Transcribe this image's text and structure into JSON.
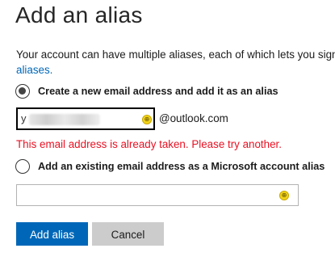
{
  "page": {
    "title": "Add an alias",
    "description_line1": "Your account can have multiple aliases, each of which lets you sign",
    "description_link": "aliases."
  },
  "options": {
    "new_email_label": "Create a new email address and add it as an alias",
    "existing_email_label": "Add an existing email address as a Microsoft account alias"
  },
  "new_email": {
    "value_prefix": "y",
    "domain": "@outlook.com",
    "error": "This email address is already taken. Please try another."
  },
  "existing_email": {
    "value": ""
  },
  "buttons": {
    "add": "Add alias",
    "cancel": "Cancel"
  },
  "colors": {
    "primary": "#0067b8",
    "error": "#e81123",
    "secondary_button": "#cccccc"
  }
}
